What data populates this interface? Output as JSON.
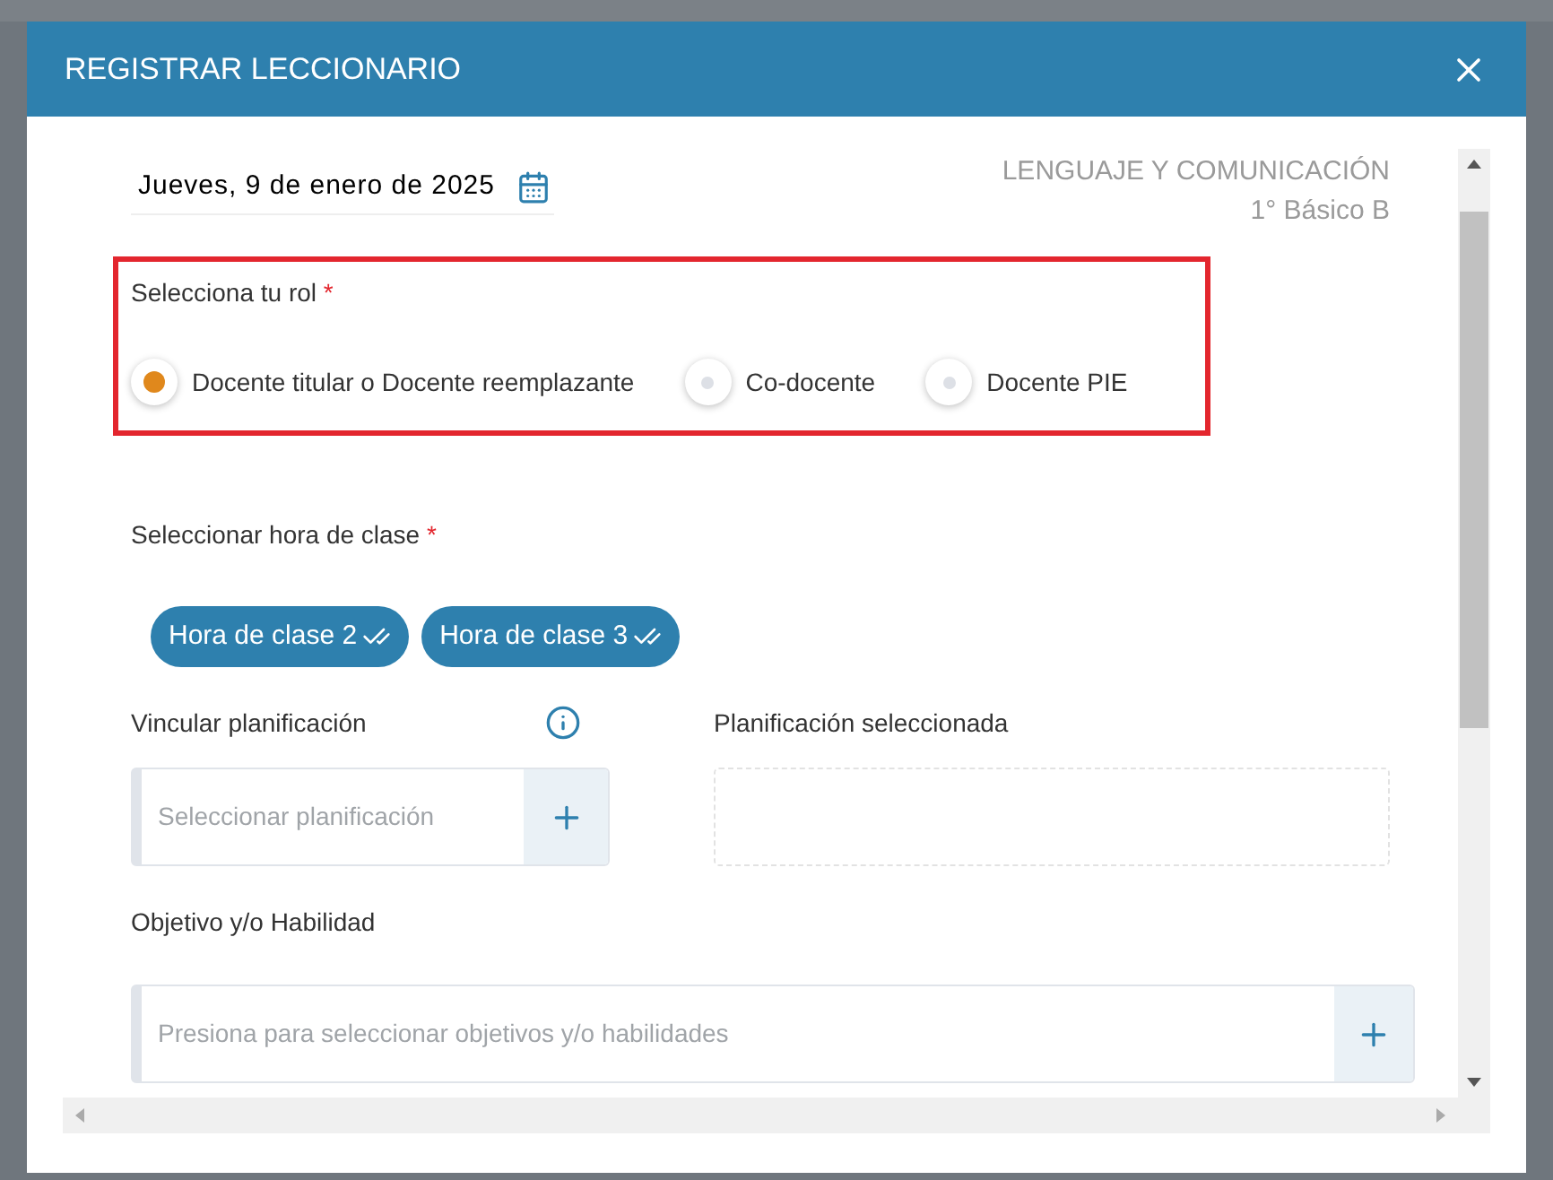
{
  "modal": {
    "title": "REGISTRAR LECCIONARIO"
  },
  "date": "Jueves, 9 de enero de 2025",
  "course": {
    "subject": "LENGUAJE Y COMUNICACIÓN",
    "grade": "1° Básico B"
  },
  "role": {
    "label": "Selecciona tu rol",
    "required_mark": "*",
    "options": [
      {
        "label": "Docente titular o Docente reemplazante",
        "selected": true
      },
      {
        "label": "Co-docente",
        "selected": false
      },
      {
        "label": "Docente PIE",
        "selected": false
      }
    ]
  },
  "class_hours": {
    "label": "Seleccionar hora de clase",
    "required_mark": "*",
    "chips": [
      {
        "label": "Hora de clase 2",
        "selected": true
      },
      {
        "label": "Hora de clase 3",
        "selected": true
      }
    ]
  },
  "planning": {
    "label": "Vincular planificación",
    "placeholder": "Seleccionar planificación",
    "selected_label": "Planificación seleccionada"
  },
  "objective": {
    "label": "Objetivo y/o Habilidad",
    "placeholder": "Presiona para seleccionar objetivos y/o habilidades"
  }
}
